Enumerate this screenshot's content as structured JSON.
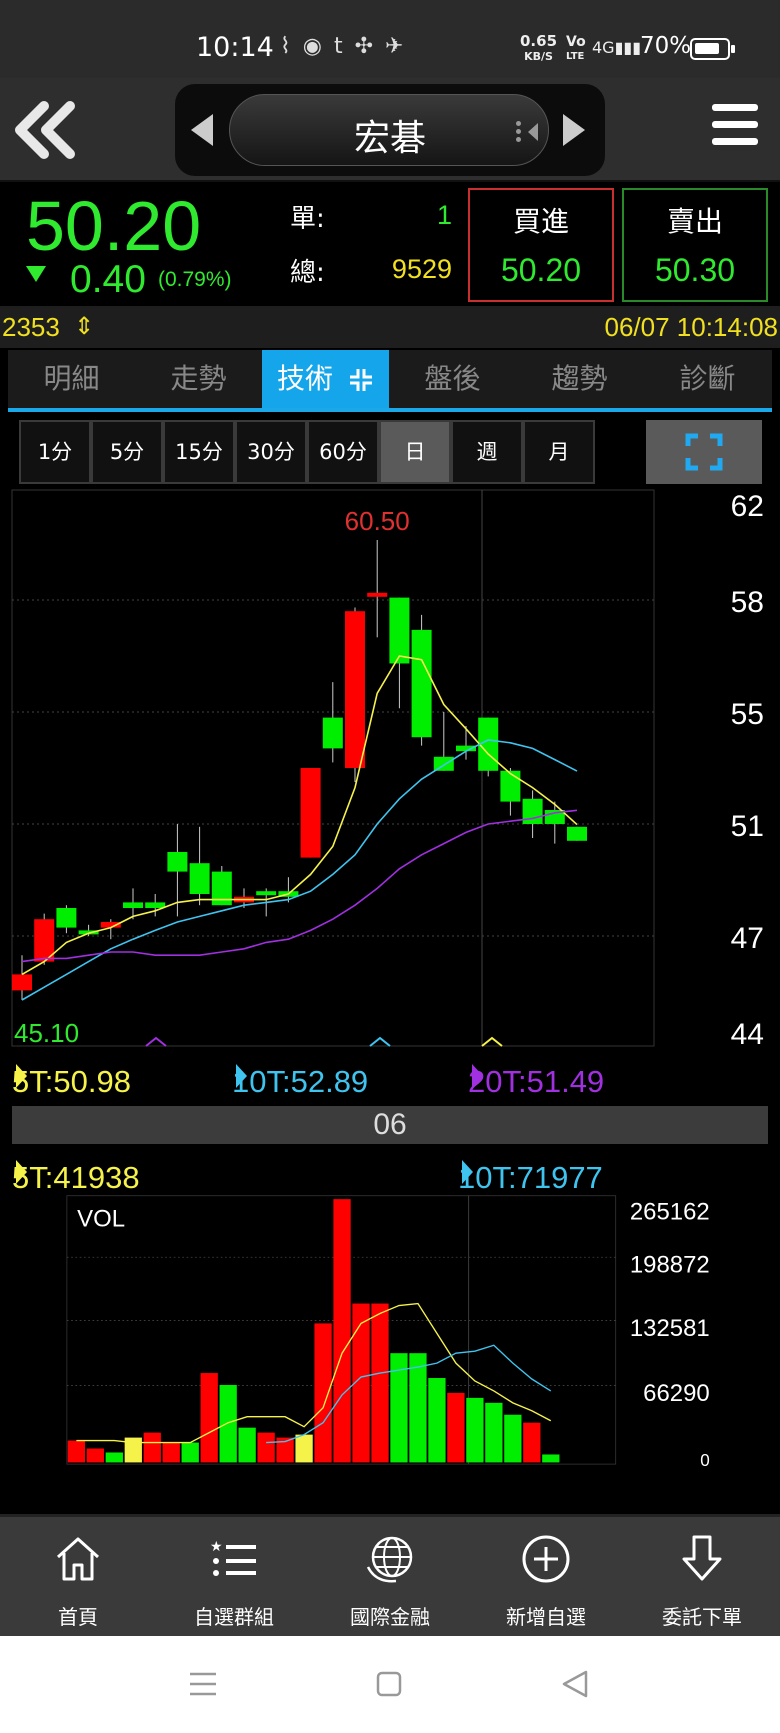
{
  "status": {
    "time": "10:14",
    "net_speed_top": "0.65",
    "net_speed_unit": "KB/S",
    "lte_top": "Vo",
    "lte_bottom": "LTE",
    "signal": "4G",
    "battery": "70%"
  },
  "header": {
    "stock_name": "宏碁"
  },
  "quote": {
    "price": "50.20",
    "change": "0.40",
    "change_pct": "(0.79%)",
    "single_label": "單:",
    "single_value": "1",
    "total_label": "總:",
    "total_value": "9529",
    "buy_label": "買進",
    "buy_value": "50.20",
    "sell_label": "賣出",
    "sell_value": "50.30"
  },
  "ticker": {
    "code": "2353",
    "datetime": "06/07 10:14:08"
  },
  "tabs": [
    "明細",
    "走勢",
    "技術",
    "盤後",
    "趨勢",
    "診斷"
  ],
  "periods": [
    "1分",
    "5分",
    "15分",
    "30分",
    "60分",
    "日",
    "週",
    "月"
  ],
  "price_ma": {
    "ma5": "5T:50.98",
    "ma10": "10T:52.89",
    "ma20": "20T:51.49"
  },
  "date_label": "06",
  "vol_ma": {
    "ma5": "5T:41938",
    "ma10": "10T:71977"
  },
  "nav": [
    "首頁",
    "自選群組",
    "國際金融",
    "新增自選",
    "委託下單"
  ],
  "colors": {
    "up": "#ff0000",
    "down": "#00ee00",
    "ma5": "#f5f24a",
    "ma10": "#3fc4f0",
    "ma20": "#a030e0",
    "accent": "#14a5ea"
  },
  "chart_data": [
    {
      "type": "candlestick",
      "title": "",
      "high_label": "60.50",
      "low_label": "45.10",
      "y_ticks": [
        "62",
        "58",
        "55",
        "51",
        "47",
        "44"
      ],
      "ylim": [
        44,
        62
      ],
      "candles": [
        {
          "o": 45.3,
          "c": 45.8,
          "h": 46.4,
          "l": 45.0,
          "dir": "up"
        },
        {
          "o": 46.2,
          "c": 47.6,
          "h": 47.8,
          "l": 46.1,
          "dir": "up"
        },
        {
          "o": 48.0,
          "c": 47.3,
          "h": 48.1,
          "l": 47.1,
          "dir": "down"
        },
        {
          "o": 47.2,
          "c": 47.2,
          "h": 47.4,
          "l": 47.0,
          "dir": "down"
        },
        {
          "o": 47.3,
          "c": 47.5,
          "h": 47.6,
          "l": 46.9,
          "dir": "up"
        },
        {
          "o": 48.2,
          "c": 48.0,
          "h": 48.7,
          "l": 47.6,
          "dir": "down"
        },
        {
          "o": 48.2,
          "c": 48.0,
          "h": 48.5,
          "l": 47.7,
          "dir": "down"
        },
        {
          "o": 50.0,
          "c": 49.3,
          "h": 51.0,
          "l": 47.7,
          "dir": "down"
        },
        {
          "o": 49.6,
          "c": 48.5,
          "h": 50.9,
          "l": 48.1,
          "dir": "down"
        },
        {
          "o": 49.3,
          "c": 48.1,
          "h": 49.5,
          "l": 48.1,
          "dir": "down"
        },
        {
          "o": 48.2,
          "c": 48.4,
          "h": 48.7,
          "l": 48.0,
          "dir": "up"
        },
        {
          "o": 48.6,
          "c": 48.6,
          "h": 48.7,
          "l": 47.7,
          "dir": "down"
        },
        {
          "o": 48.6,
          "c": 48.4,
          "h": 49.1,
          "l": 48.2,
          "dir": "down"
        },
        {
          "o": 49.8,
          "c": 53.0,
          "h": 53.0,
          "l": 49.8,
          "dir": "up"
        },
        {
          "o": 54.8,
          "c": 53.7,
          "h": 55.8,
          "l": 53.2,
          "dir": "down"
        },
        {
          "o": 53.0,
          "c": 57.7,
          "h": 57.8,
          "l": 52.5,
          "dir": "up"
        },
        {
          "o": 58.3,
          "c": 58.3,
          "h": 60.5,
          "l": 57.0,
          "dir": "up"
        },
        {
          "o": 58.1,
          "c": 56.3,
          "h": 58.1,
          "l": 55.1,
          "dir": "down"
        },
        {
          "o": 57.2,
          "c": 54.1,
          "h": 57.6,
          "l": 53.8,
          "dir": "down"
        },
        {
          "o": 53.4,
          "c": 52.9,
          "h": 55.0,
          "l": 52.9,
          "dir": "down"
        },
        {
          "o": 53.8,
          "c": 53.6,
          "h": 54.5,
          "l": 53.3,
          "dir": "down"
        },
        {
          "o": 54.8,
          "c": 52.9,
          "h": 54.8,
          "l": 52.7,
          "dir": "down"
        },
        {
          "o": 52.9,
          "c": 51.8,
          "h": 53.0,
          "l": 51.3,
          "dir": "down"
        },
        {
          "o": 51.9,
          "c": 51.0,
          "h": 52.2,
          "l": 50.5,
          "dir": "down"
        },
        {
          "o": 51.5,
          "c": 51.0,
          "h": 51.8,
          "l": 50.3,
          "dir": "down"
        },
        {
          "o": 50.9,
          "c": 50.4,
          "h": 50.9,
          "l": 50.4,
          "dir": "down"
        }
      ],
      "series": [
        {
          "name": "5T",
          "values": [
            45.8,
            46.2,
            46.8,
            47.1,
            47.3,
            47.7,
            47.9,
            48.2,
            48.3,
            48.3,
            48.3,
            48.3,
            48.5,
            49.2,
            50.2,
            52.3,
            55.5,
            56.5,
            56.4,
            55.2,
            54.4,
            53.5,
            52.8,
            52.3,
            51.7,
            50.98
          ]
        },
        {
          "name": "10T",
          "values": [
            45.0,
            45.4,
            45.8,
            46.2,
            46.6,
            46.9,
            47.2,
            47.5,
            47.7,
            47.9,
            48.1,
            48.2,
            48.3,
            48.6,
            49.2,
            49.9,
            51.0,
            51.9,
            52.6,
            53.1,
            53.6,
            54.0,
            53.9,
            53.7,
            53.3,
            52.89
          ]
        },
        {
          "name": "20T",
          "values": [
            46.2,
            46.3,
            46.3,
            46.4,
            46.5,
            46.5,
            46.4,
            46.4,
            46.4,
            46.5,
            46.6,
            46.8,
            46.9,
            47.2,
            47.6,
            48.1,
            48.7,
            49.4,
            49.9,
            50.3,
            50.7,
            51.0,
            51.1,
            51.2,
            51.4,
            51.49
          ]
        }
      ]
    },
    {
      "type": "bar",
      "title": "VOL",
      "y_ticks": [
        "265162",
        "198872",
        "132581",
        "66290",
        "0"
      ],
      "ylim": [
        0,
        265162
      ],
      "values": [
        22000,
        14000,
        10000,
        25000,
        30000,
        20000,
        20000,
        90000,
        78000,
        35000,
        30000,
        25000,
        28000,
        140000,
        265162,
        160000,
        160000,
        110000,
        110000,
        85000,
        70000,
        65000,
        60000,
        48000,
        40000,
        8000
      ],
      "colors": [
        "up",
        "up",
        "down",
        "neutral",
        "up",
        "up",
        "down",
        "up",
        "down",
        "down",
        "up",
        "up",
        "neutral",
        "up",
        "up",
        "up",
        "up",
        "down",
        "down",
        "down",
        "up",
        "down",
        "down",
        "down",
        "up",
        "down"
      ],
      "series": [
        {
          "name": "5T",
          "values": [
            22000,
            22000,
            22000,
            20000,
            20000,
            20000,
            20000,
            30000,
            40000,
            46000,
            46000,
            46000,
            36000,
            55000,
            110000,
            140000,
            150000,
            158000,
            160000,
            130000,
            100000,
            82000,
            72000,
            60000,
            52000,
            41938
          ]
        },
        {
          "name": "10T",
          "values": [
            null,
            null,
            null,
            null,
            null,
            null,
            null,
            null,
            null,
            null,
            20000,
            21000,
            28000,
            40000,
            68000,
            86000,
            90000,
            93000,
            96000,
            100000,
            110000,
            112000,
            118000,
            100000,
            84000,
            71977
          ]
        }
      ]
    }
  ]
}
